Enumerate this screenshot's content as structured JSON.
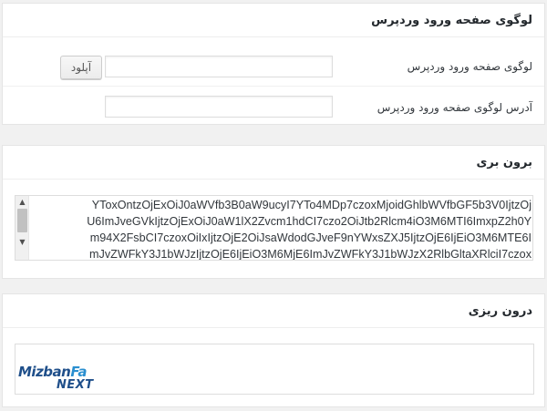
{
  "logo_section": {
    "title": "لوگوی صفحه ورود وردپرس",
    "logo_field_label": "لوگوی صفحه ورود وردپرس",
    "upload_button_label": "آپلود",
    "logo_field_value": "",
    "address_field_label": "آدرس لوگوی صفحه ورود وردپرس",
    "address_field_value": ""
  },
  "outer_section": {
    "title": "برون بری",
    "code_lines": [
      "YToxOntzOjExOiJ0aWVfb3B0aW9ucyI7YTo4MDp7czoxMjoidGhlbWVfbGF5b3V0IjtzOj",
      "U6ImJveGVkIjtzOjExOiJ0aW1lX2Zvcm1hdCI7czo2OiJtb2Rlcm4iO3M6MTI6ImxpZ2h0Y",
      "m94X2FsbCI7czoxOiIxIjtzOjE2OiJsaWdodGJveF9nYWxsZXJ5IjtzOjE6IjEiO3M6MTE6I",
      "mJvZWFkY3J1bWJzIjtzOjE6IjEiO3M6MjE6ImJvZWFkY3J1bWJzX2RlbGltaXRlciI7czox"
    ]
  },
  "inner_section": {
    "title": "درون ریزی",
    "logo_text_main": "Mizban",
    "logo_text_accent": "Fa",
    "logo_text_sub": "NEXT"
  },
  "colors": {
    "page_background": "#f1f1f1",
    "panel_background": "#ffffff",
    "border": "#dddddd",
    "logo_dark_blue": "#1f4f8a",
    "logo_light_blue": "#2a8fd0"
  },
  "icons": [
    "scroll-up-arrow-icon",
    "scroll-down-arrow-icon",
    "mizbanfa-logo"
  ]
}
